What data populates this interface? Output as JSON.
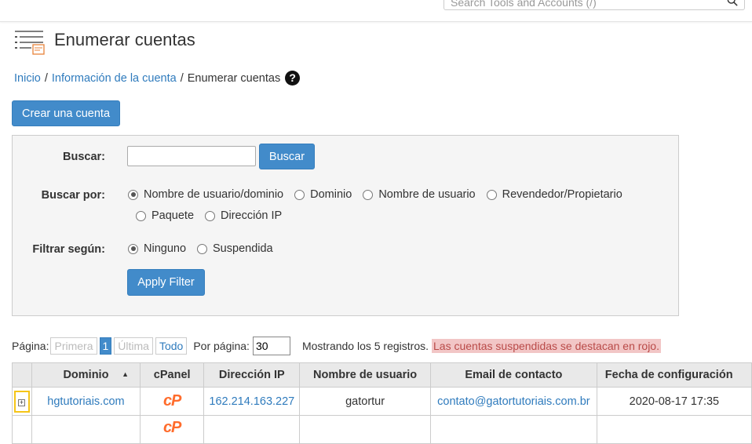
{
  "header": {
    "search_placeholder": "Search Tools and Accounts (/)",
    "search_icon": "magnifier-icon"
  },
  "page": {
    "title": "Enumerar cuentas",
    "title_icon": "list-accounts-icon"
  },
  "breadcrumb": {
    "home": "Inicio",
    "section": "Información de la cuenta",
    "current": "Enumerar cuentas",
    "help": "?"
  },
  "actions": {
    "create_account": "Crear una cuenta"
  },
  "filters": {
    "search_label": "Buscar:",
    "search_value": "",
    "search_button": "Buscar",
    "search_by_label": "Buscar por:",
    "search_by_options": [
      "Nombre de usuario/dominio",
      "Dominio",
      "Nombre de usuario",
      "Revendedor/Propietario",
      "Paquete",
      "Dirección IP"
    ],
    "search_by_selected": "Nombre de usuario/dominio",
    "filter_label": "Filtrar según:",
    "filter_options": [
      "Ninguno",
      "Suspendida"
    ],
    "filter_selected": "Ninguno",
    "apply_button": "Apply Filter"
  },
  "pagination": {
    "label": "Página:",
    "first": "Primera",
    "current": "1",
    "last": "Última",
    "all": "Todo",
    "per_page_label": "Por página:",
    "per_page_value": "30",
    "showing": "Mostrando los 5 registros.",
    "suspended_notice": "Las cuentas suspendidas se destacan en rojo."
  },
  "table": {
    "columns": [
      "",
      "Dominio",
      "cPanel",
      "Dirección IP",
      "Nombre de usuario",
      "Email de contacto",
      "Fecha de configuración"
    ],
    "sort_indicator": "▲",
    "rows": [
      {
        "domain": "hgtutoriais.com",
        "cpanel": "cP",
        "ip": "162.214.163.227",
        "username": "gatortur",
        "email": "contato@gatortutoriais.com.br",
        "setup_date": "2020-08-17 17:35"
      },
      {
        "domain": "",
        "cpanel": "cP",
        "ip": "",
        "username": "",
        "email": "",
        "setup_date": ""
      }
    ]
  },
  "colors": {
    "primary": "#428bca",
    "link": "#2f7bbd",
    "cpanel_orange": "#ff6c2c",
    "suspended_bg": "#f2c6c6",
    "highlight": "#f5c518"
  }
}
